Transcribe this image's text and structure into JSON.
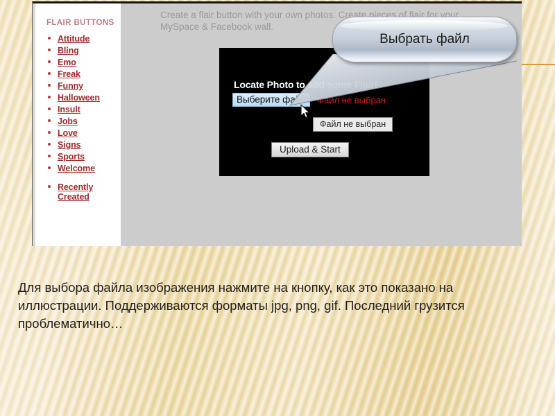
{
  "slide": {
    "caption": "Для выбора файла изображения нажмите на кнопку, как это показано на иллюстрации. Поддерживаются форматы jpg, png, gif. Последний грузится проблематично…"
  },
  "callout": {
    "label": "Выбрать файл"
  },
  "screenshot": {
    "sidebar": {
      "title": "FLAIR BUTTONS",
      "items": [
        {
          "label": "Attitude"
        },
        {
          "label": "Bling"
        },
        {
          "label": "Emo"
        },
        {
          "label": "Freak"
        },
        {
          "label": "Funny"
        },
        {
          "label": "Halloween"
        },
        {
          "label": "Insult"
        },
        {
          "label": "Jobs"
        },
        {
          "label": "Love"
        },
        {
          "label": "Signs"
        },
        {
          "label": "Sports"
        },
        {
          "label": "Welcome"
        },
        {
          "label": "Recently Created"
        }
      ]
    },
    "content": {
      "intro": "Create a flair button with your own photos. Create pieces of flair for your MySpace & Facebook wall.",
      "panel": {
        "heading": "Locate Photo to add some Flair!",
        "choose_file_label": "Выберите файл",
        "no_file_label": "Файл не выбран",
        "tooltip": "Файл не выбран",
        "upload_label": "Upload & Start"
      }
    }
  },
  "colors": {
    "link": "#a02b2b",
    "sidebar_title": "#c07d86",
    "panel_bg": "#000000",
    "error_text": "#cc2222",
    "slide_bg": "#f0dca8",
    "rule": "#d79a3a"
  }
}
